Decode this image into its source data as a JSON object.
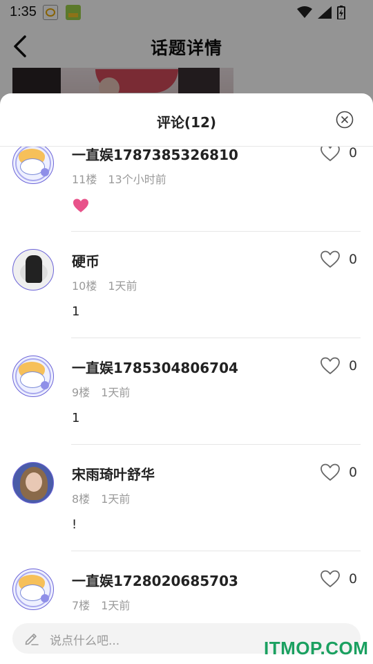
{
  "status_bar": {
    "time": "1:35"
  },
  "page": {
    "title": "话题详情"
  },
  "sheet": {
    "title": "评论(12)",
    "comments": [
      {
        "name": "一直娱1787385326810",
        "floor": "11楼",
        "time": "13个小时前",
        "content": "",
        "content_icon": "heart-emoji",
        "likes": "0",
        "avatar": "cartoon"
      },
      {
        "name": "硬币",
        "floor": "10楼",
        "time": "1天前",
        "content": "1",
        "likes": "0",
        "avatar": "photo"
      },
      {
        "name": "一直娱1785304806704",
        "floor": "9楼",
        "time": "1天前",
        "content": "1",
        "likes": "0",
        "avatar": "cartoon"
      },
      {
        "name": "宋雨琦叶舒华",
        "floor": "8楼",
        "time": "1天前",
        "content": "!",
        "likes": "0",
        "avatar": "photo"
      },
      {
        "name": "一直娱1728020685703",
        "floor": "7楼",
        "time": "1天前",
        "content": "",
        "likes": "0",
        "avatar": "cartoon"
      }
    ],
    "input_placeholder": "说点什么吧..."
  },
  "watermark": "ITMOP.COM",
  "colors": {
    "accent_heart": "#e8528a",
    "avatar_border": "#6b63d8",
    "watermark": "#1aa060"
  }
}
